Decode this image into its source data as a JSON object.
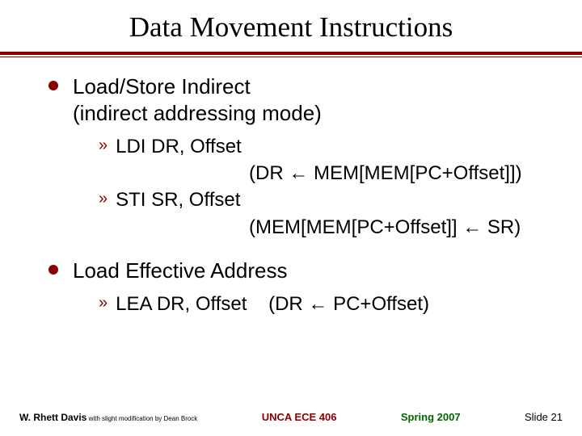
{
  "title": "Data Movement Instructions",
  "sections": [
    {
      "heading": "Load/Store Indirect\n(indirect addressing mode)",
      "items": [
        {
          "label": "LDI DR, Offset",
          "detail": "(DR ←  MEM[MEM[PC+Offset]])"
        },
        {
          "label": "STI SR, Offset",
          "detail": "(MEM[MEM[PC+Offset]] ← SR)"
        }
      ]
    },
    {
      "heading": "Load Effective Address",
      "items": [
        {
          "label": "LEA DR, Offset",
          "detail_inline": "(DR ← PC+Offset)"
        }
      ]
    }
  ],
  "footer": {
    "author": "W. Rhett Davis",
    "author_mod": " with slight modification by Dean Brock",
    "course": "UNCA ECE 406",
    "term": "Spring 2007",
    "slidenum": "Slide 21"
  }
}
